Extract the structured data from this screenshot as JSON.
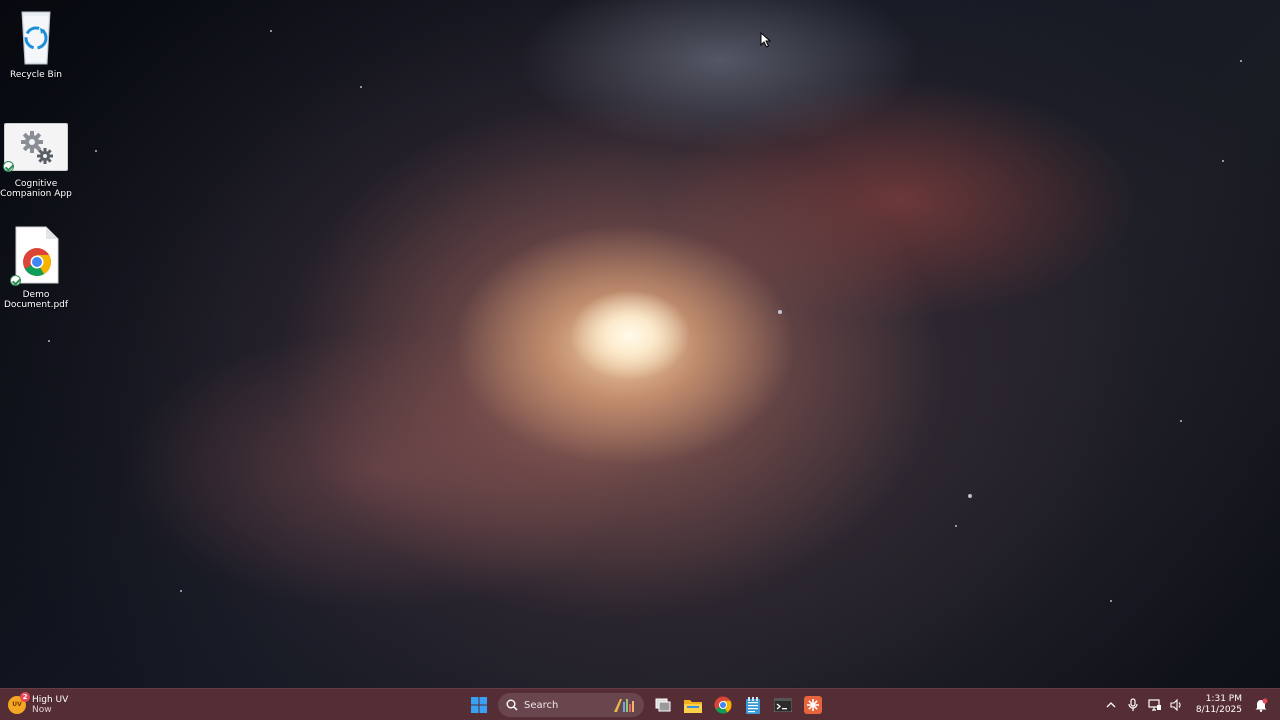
{
  "desktop": {
    "icons": [
      {
        "label": "Recycle Bin",
        "icon": "recycle-bin-icon"
      },
      {
        "label": "Cognitive Companion App",
        "icon": "gear-icon"
      },
      {
        "label": "Demo Document.pdf",
        "icon": "chrome-pdf-icon"
      }
    ]
  },
  "taskbar": {
    "weather": {
      "badge": "2",
      "sun_text": "UV",
      "title": "High UV",
      "subtitle": "Now"
    },
    "search": {
      "placeholder": "Search"
    },
    "apps": [
      "start-icon",
      "task-view-icon",
      "file-explorer-icon",
      "chrome-icon",
      "notepad-icon",
      "terminal-icon",
      "snipping-tool-icon"
    ],
    "tray": {
      "time": "1:31 PM",
      "date": "8/11/2025"
    }
  },
  "colors": {
    "taskbar_bg": "#5c3038",
    "accent": "#0078d4"
  }
}
